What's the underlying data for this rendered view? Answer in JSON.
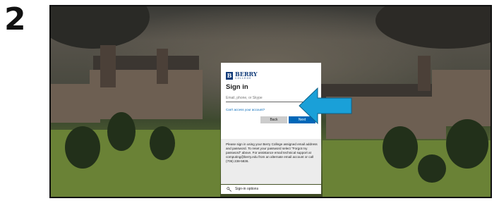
{
  "step_number": "2",
  "login": {
    "brand_name": "BERRY",
    "brand_sub": "COLLEGE",
    "logo_letter": "B",
    "title": "Sign in",
    "email_placeholder": "Email, phone, or Skype",
    "cant_access_link": "Can't access your account?",
    "back_label": "Back",
    "next_label": "Next",
    "help_text": "Please sign in using your Berry College assigned email address and password. To reset your password select \"Forgot my password\" above. For assistance email technical support at computing@berry.edu from an alternate email account or call (706) 238-5836.",
    "signin_options_label": "Sign-in options"
  },
  "annotation": {
    "arrow_color": "#1aa0d8",
    "arrow_target": "email-field"
  },
  "colors": {
    "brand": "#123c7a",
    "accent": "#0067b8"
  },
  "icons": {
    "signin_options": "key-icon"
  }
}
